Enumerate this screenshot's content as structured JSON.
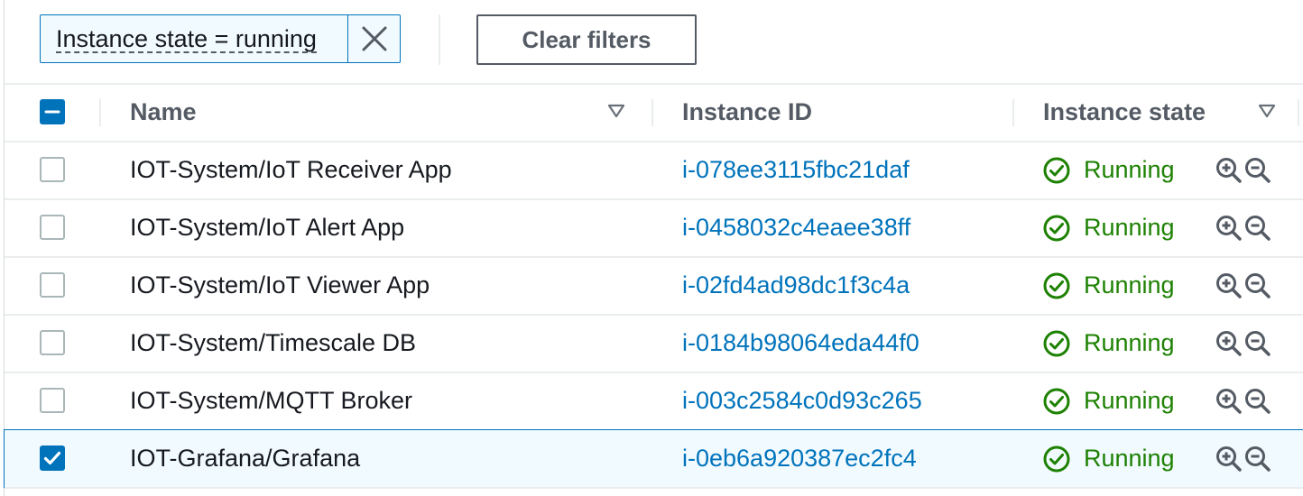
{
  "filter": {
    "token_label": "Instance state = running",
    "remove_icon": "close-icon",
    "clear_label": "Clear filters"
  },
  "table": {
    "columns": {
      "name": "Name",
      "instance_id": "Instance ID",
      "instance_state": "Instance state"
    },
    "header_checkbox_state": "indeterminate",
    "rows": [
      {
        "name": "IOT-System/IoT Receiver App",
        "instance_id": "i-078ee3115fbc21daf",
        "state": "Running",
        "selected": false
      },
      {
        "name": "IOT-System/IoT Alert App",
        "instance_id": "i-0458032c4eaee38ff",
        "state": "Running",
        "selected": false
      },
      {
        "name": "IOT-System/IoT Viewer App",
        "instance_id": "i-02fd4ad98dc1f3c4a",
        "state": "Running",
        "selected": false
      },
      {
        "name": "IOT-System/Timescale DB",
        "instance_id": "i-0184b98064eda44f0",
        "state": "Running",
        "selected": false
      },
      {
        "name": "IOT-System/MQTT Broker",
        "instance_id": "i-003c2584c0d93c265",
        "state": "Running",
        "selected": false
      },
      {
        "name": "IOT-Grafana/Grafana",
        "instance_id": "i-0eb6a920387ec2fc4",
        "state": "Running",
        "selected": true
      }
    ]
  },
  "colors": {
    "link": "#0073bb",
    "success": "#1d8102",
    "header_text": "#545b64",
    "selected_row_bg": "#f1faff"
  }
}
